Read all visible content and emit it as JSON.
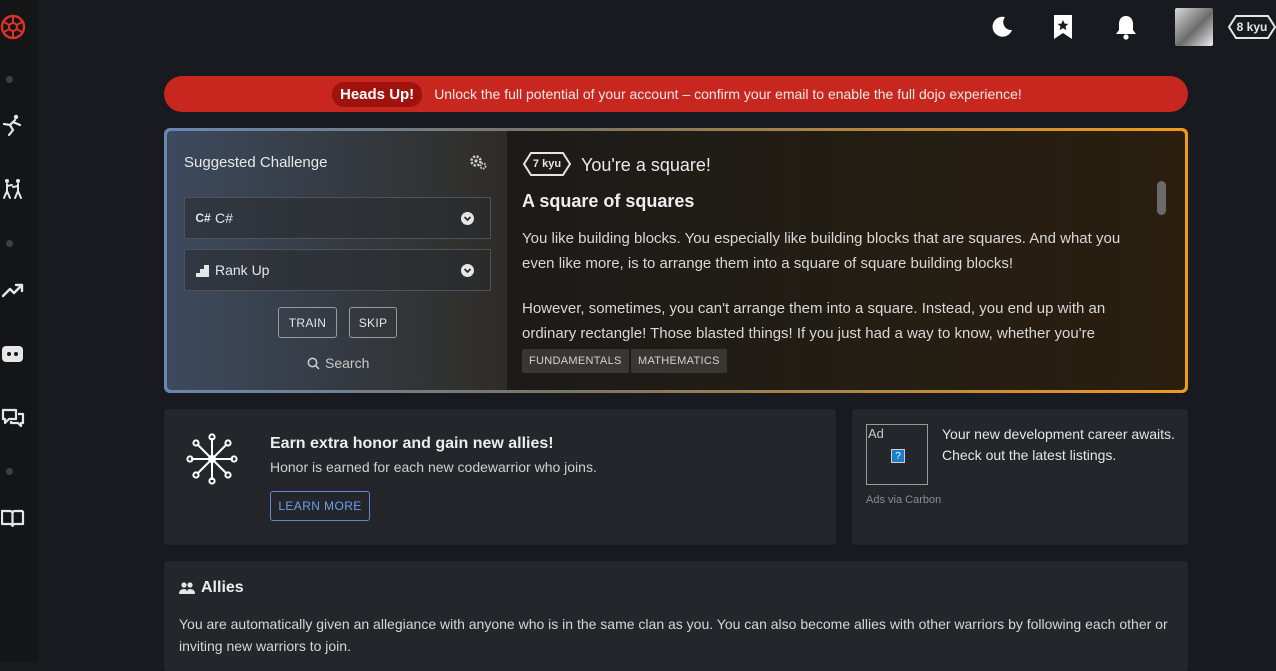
{
  "topbar": {
    "rank_label": "8 kyu"
  },
  "alert": {
    "badge": "Heads Up!",
    "message": "Unlock the full potential of your account – confirm your email to enable the full dojo experience!"
  },
  "challenge": {
    "title": "Suggested Challenge",
    "language": {
      "icon_text": "C#",
      "label": "C#"
    },
    "strategy": {
      "label": "Rank Up"
    },
    "train_label": "TRAIN",
    "skip_label": "SKIP",
    "search_label": "Search",
    "kata": {
      "rank": "7 kyu",
      "name": "You're a square!",
      "heading": "A square of squares",
      "paragraphs": [
        "You like building blocks. You especially like building blocks that are squares. And what you even like more, is to arrange them into a square of square building blocks!",
        "However, sometimes, you can't arrange them into a square. Instead, you end up with an ordinary rectangle! Those blasted things! If you just had a way to know, whether you're"
      ],
      "tags": [
        "FUNDAMENTALS",
        "MATHEMATICS"
      ]
    }
  },
  "honor": {
    "title": "Earn extra honor and gain new allies!",
    "subtitle": "Honor is earned for each new codewarrior who joins.",
    "button": "LEARN MORE"
  },
  "ad": {
    "box_label": "Ad",
    "text": "Your new development career awaits. Check out the latest listings.",
    "via": "Ads via Carbon"
  },
  "allies": {
    "title": "Allies",
    "text": "You are automatically given an allegiance with anyone who is in the same clan as you. You can also become allies with other warriors by following each other or inviting new warriors to join."
  },
  "colors": {
    "brand_red": "#e0302a",
    "alert_bg": "#c7271f",
    "accent_orange": "#f29a1c",
    "link_blue": "#6aa0e8"
  }
}
